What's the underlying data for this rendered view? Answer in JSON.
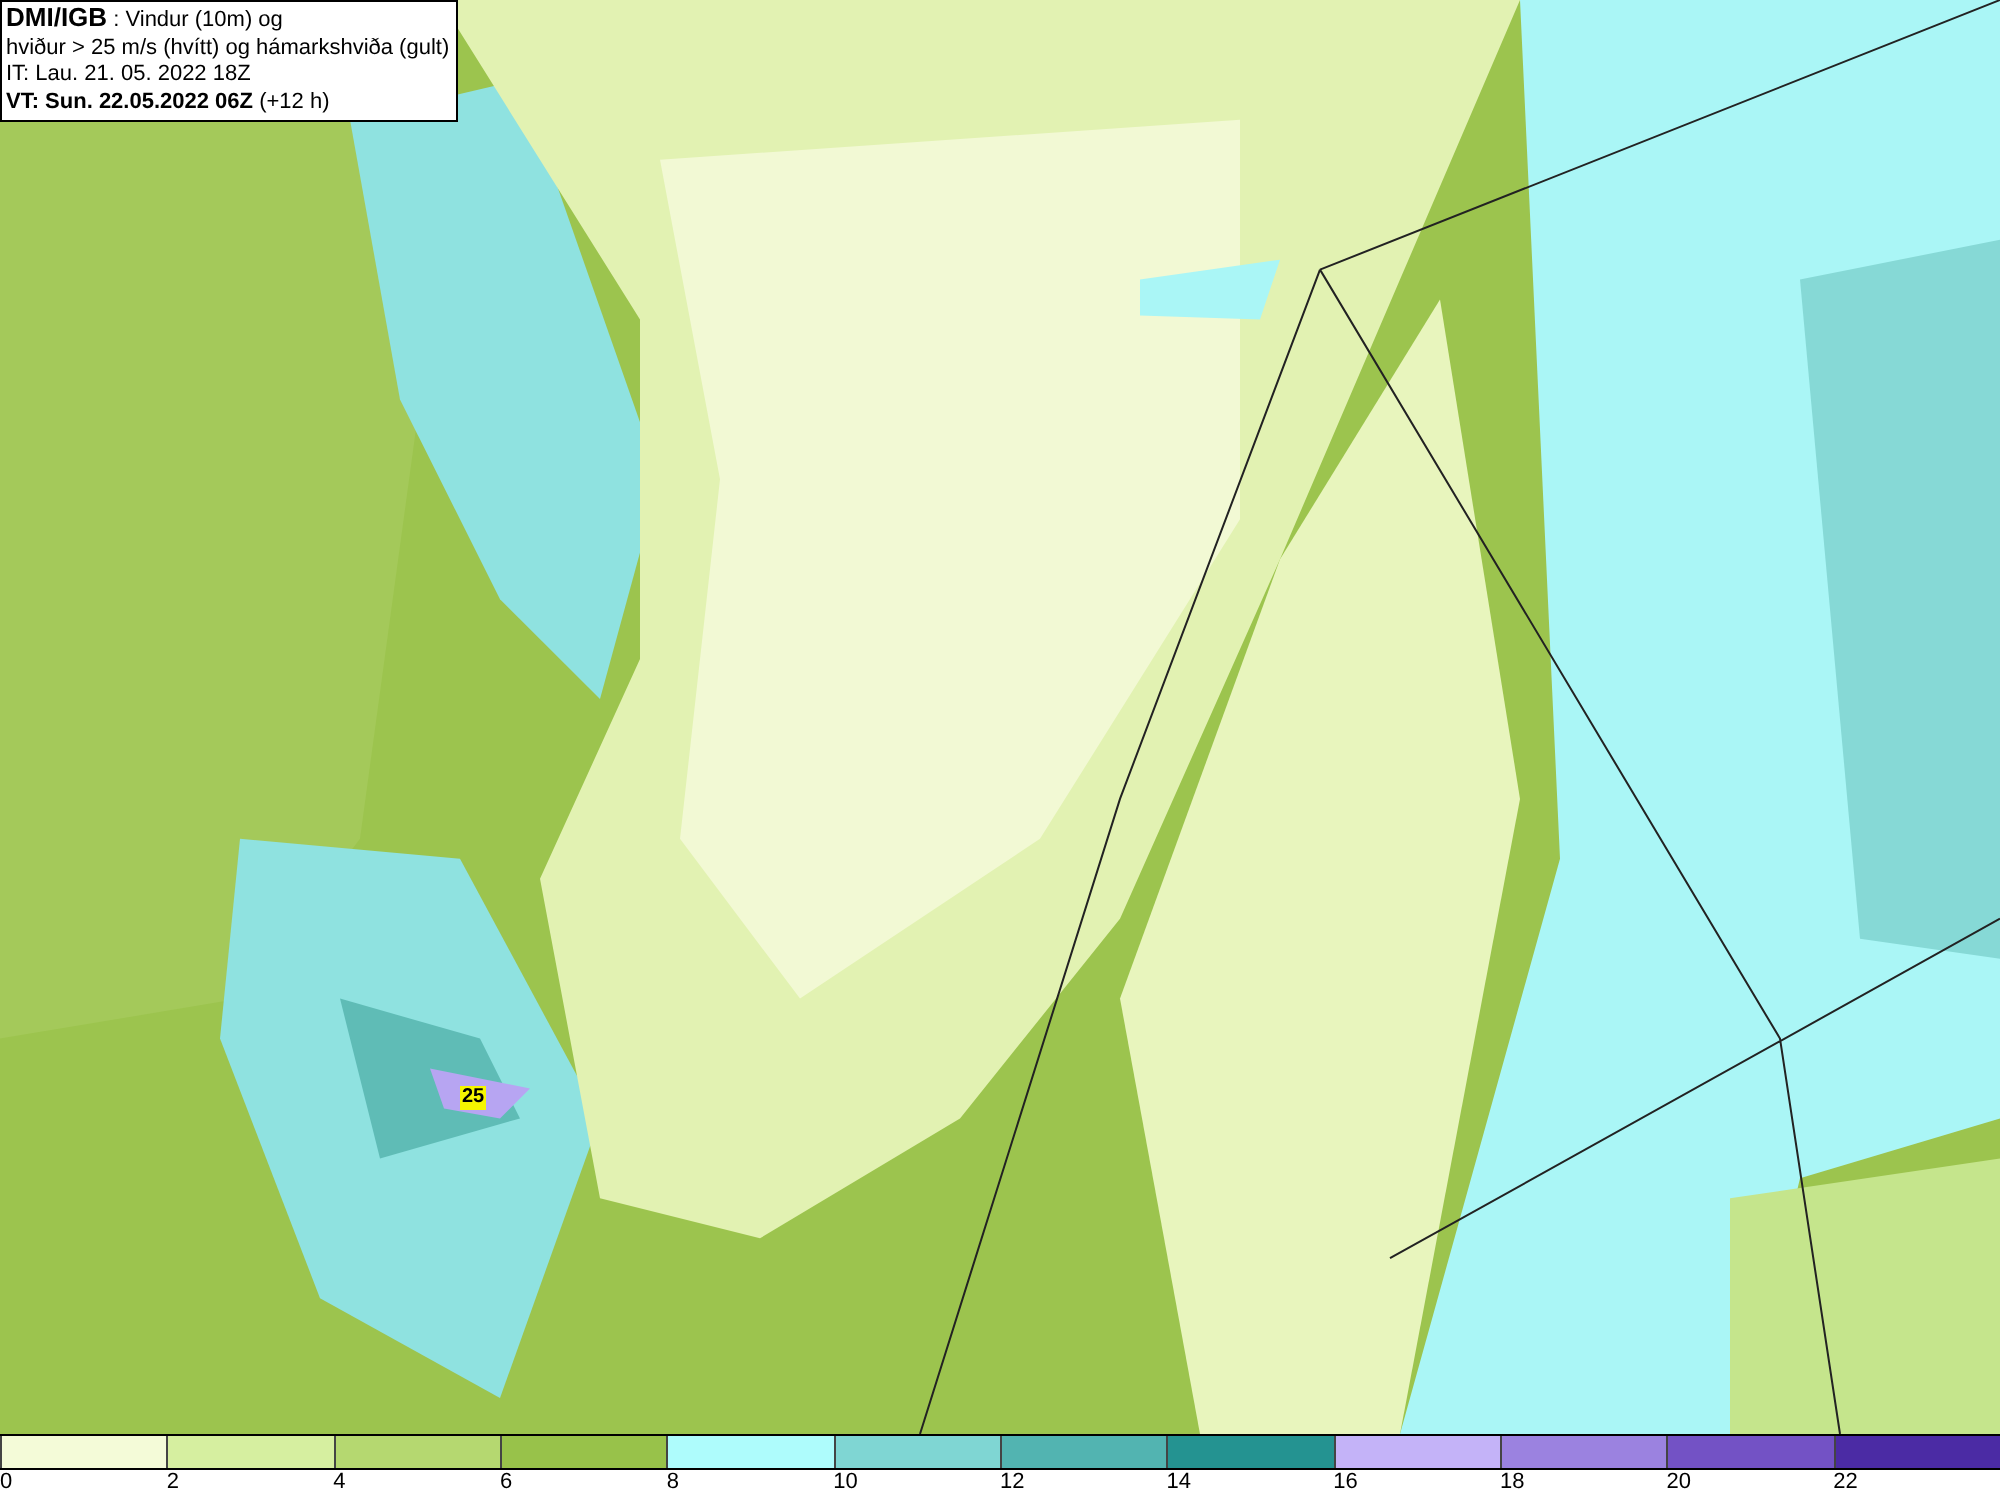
{
  "header": {
    "source": "DMI/IGB",
    "title": " : Vindur (10m) og",
    "subtitle": "hviður > 25 m/s (hvítt) og hámarkshviða (gult)",
    "initial_time": "IT: Lau. 21. 05. 2022 18Z",
    "valid_time": "VT: Sun. 22.05.2022 06Z",
    "valid_offset": " (+12 h)"
  },
  "map": {
    "gust_label": "25"
  },
  "legend": [
    {
      "label": "0",
      "color": "#f4fbd8"
    },
    {
      "label": "2",
      "color": "#d6efa0"
    },
    {
      "label": "4",
      "color": "#b5d870"
    },
    {
      "label": "6",
      "color": "#98c24a"
    },
    {
      "label": "8",
      "color": "#aefcfc"
    },
    {
      "label": "10",
      "color": "#7fd6d3"
    },
    {
      "label": "12",
      "color": "#52b4b1"
    },
    {
      "label": "14",
      "color": "#249391"
    },
    {
      "label": "16",
      "color": "#c4b3f8"
    },
    {
      "label": "18",
      "color": "#9b82e0"
    },
    {
      "label": "20",
      "color": "#7352c5"
    },
    {
      "label": "22",
      "color": "#4b2ba4"
    }
  ]
}
